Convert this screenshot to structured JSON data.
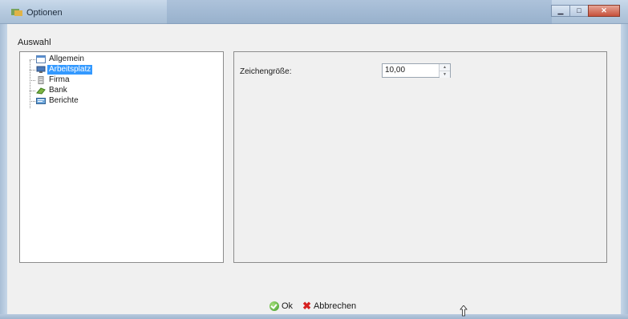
{
  "window": {
    "title": "Optionen",
    "icon": "options-app-icon",
    "controls": {
      "minimize": "minimize-icon",
      "maximize": "maximize-icon",
      "close": "close-icon"
    }
  },
  "selection": {
    "group_label": "Auswahl",
    "items": [
      {
        "label": "Allgemein",
        "icon": "general-icon"
      },
      {
        "label": "Arbeitsplatz",
        "icon": "workplace-icon",
        "selected": true
      },
      {
        "label": "Firma",
        "icon": "company-icon"
      },
      {
        "label": "Bank",
        "icon": "bank-icon"
      },
      {
        "label": "Berichte",
        "icon": "reports-icon"
      }
    ]
  },
  "settings": {
    "font_size_label": "Zeichengröße:",
    "font_size_value": "10,00"
  },
  "footer": {
    "ok_label": "Ok",
    "cancel_label": "Abbrechen"
  },
  "colors": {
    "selection": "#3399ff",
    "ok": "#3f9b2a",
    "cancel": "#d62020"
  }
}
